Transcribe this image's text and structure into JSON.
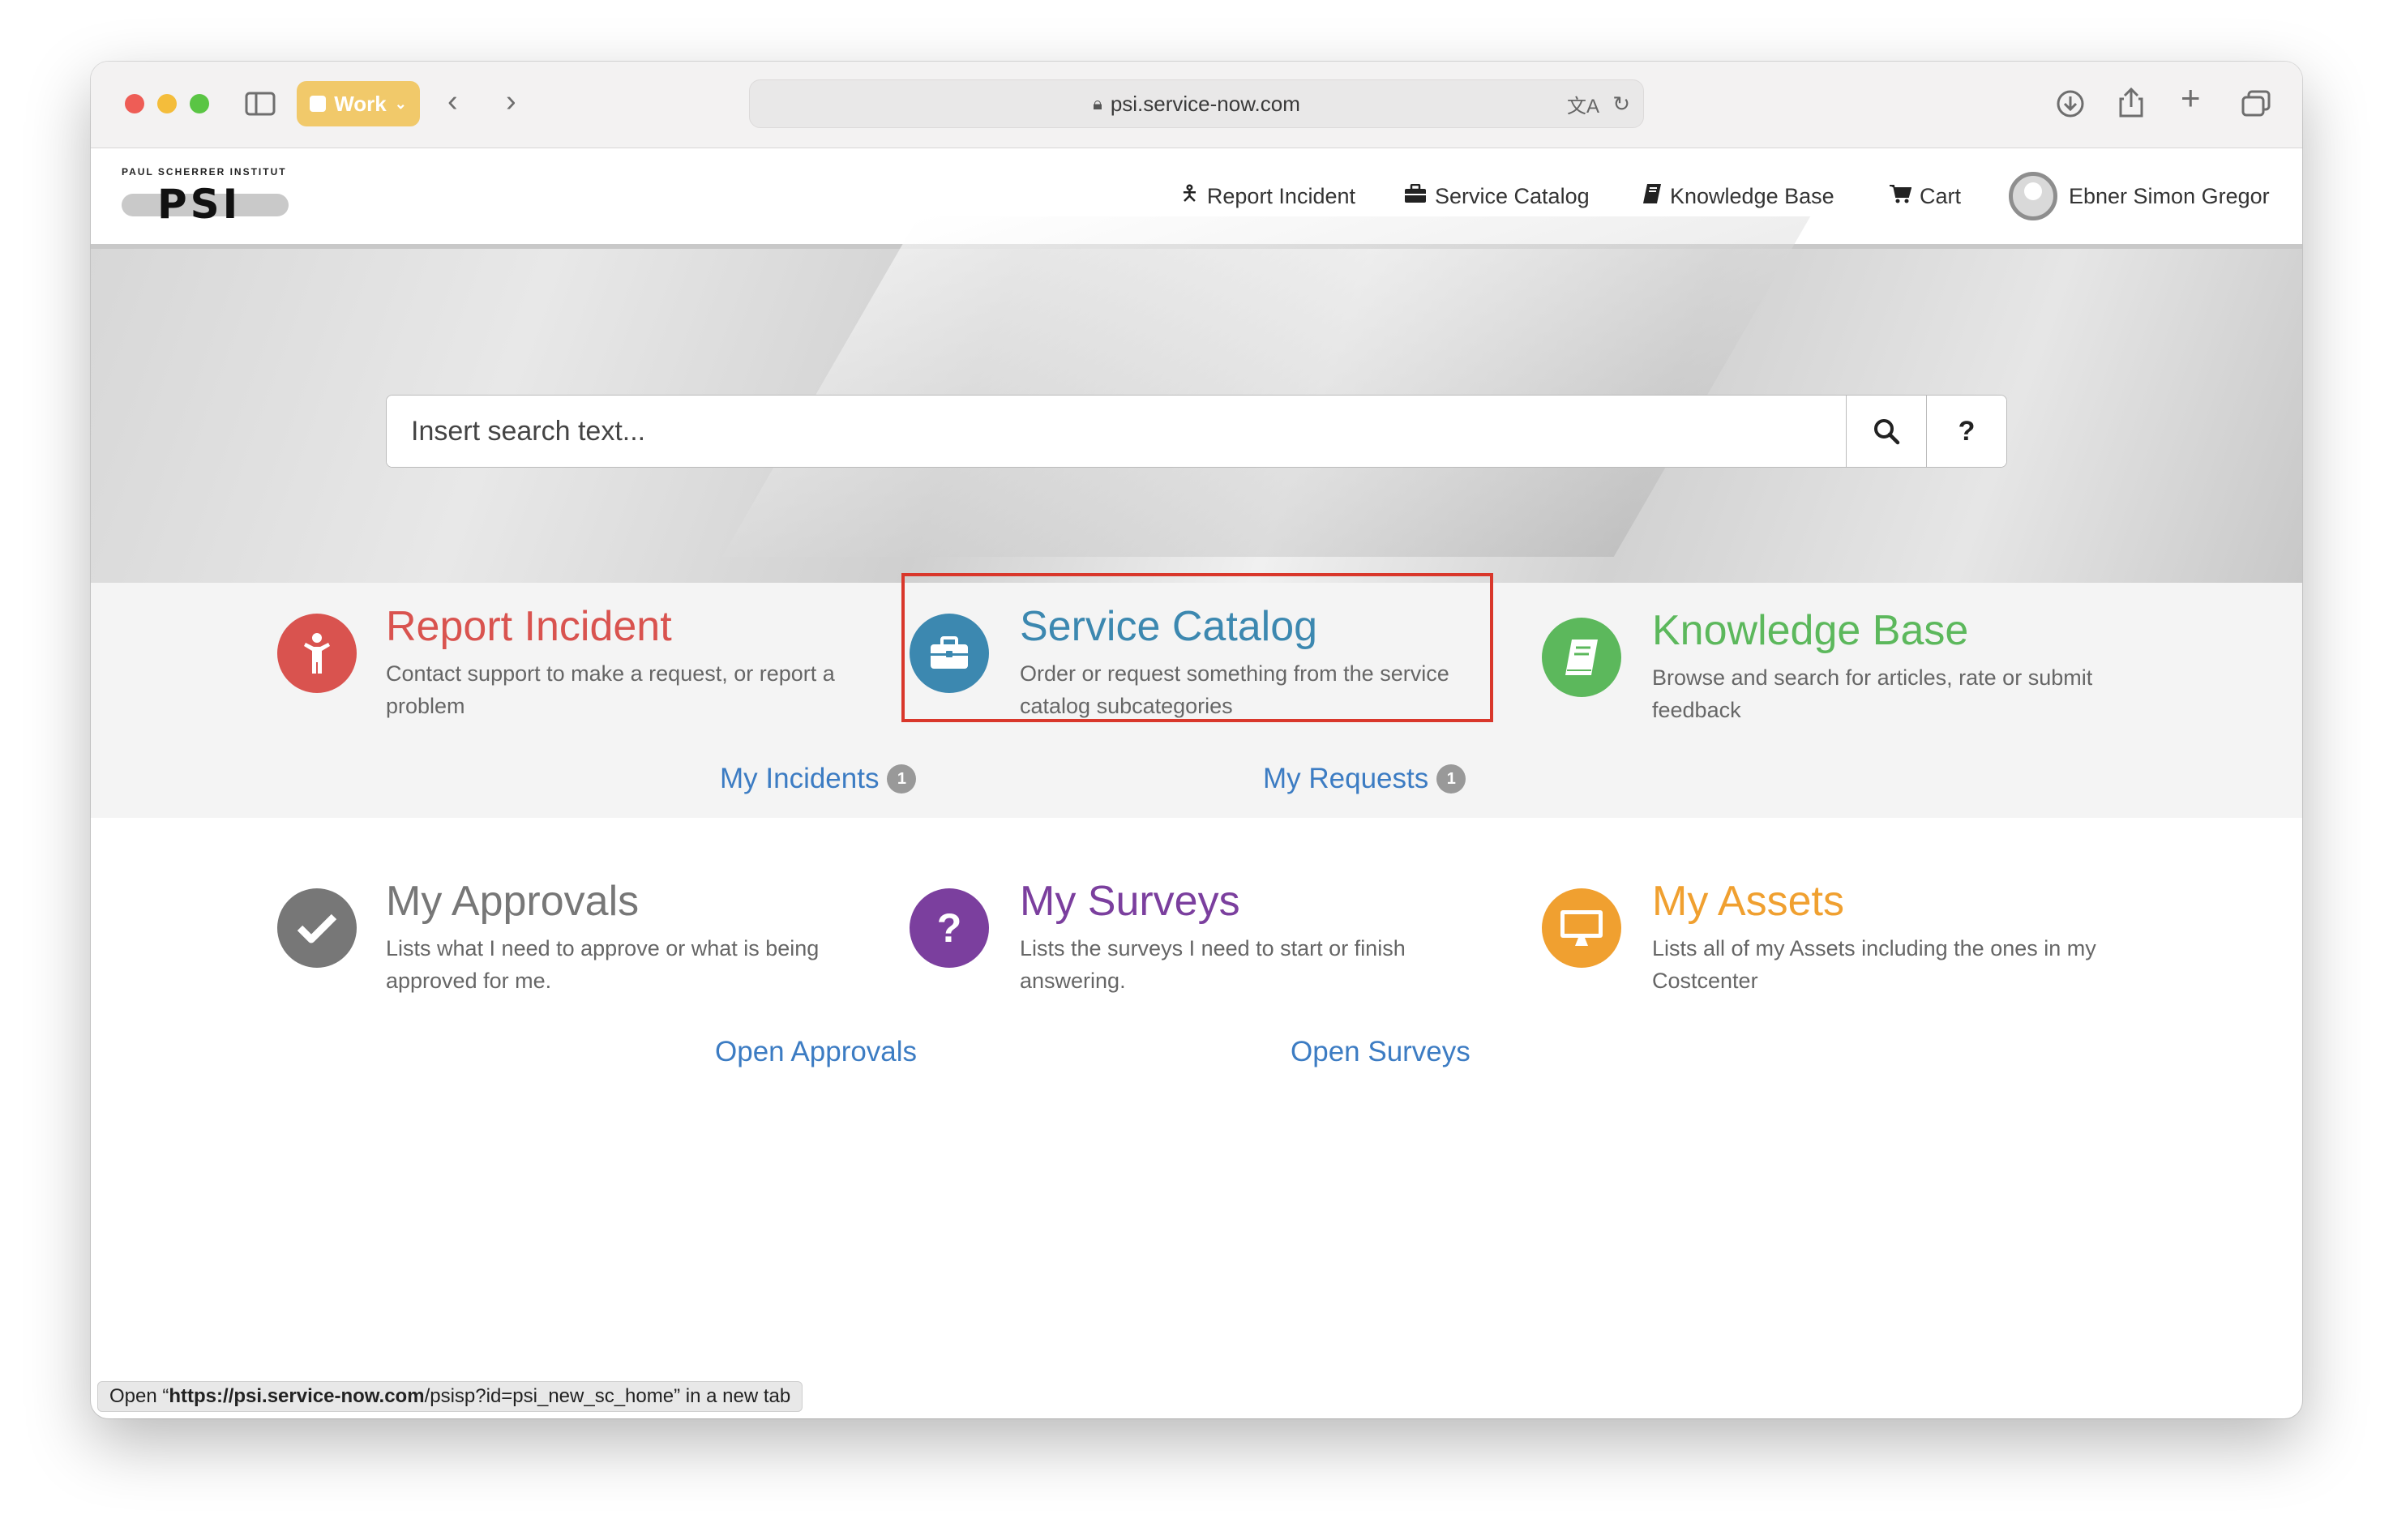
{
  "browser": {
    "tab_group": "Work",
    "url": "psi.service-now.com"
  },
  "header": {
    "logo_text": "PAUL SCHERRER INSTITUT",
    "logo_mark": "PSI",
    "nav": [
      {
        "label": "Report Incident",
        "icon": "person-icon"
      },
      {
        "label": "Service Catalog",
        "icon": "briefcase-icon"
      },
      {
        "label": "Knowledge Base",
        "icon": "book-icon"
      },
      {
        "label": "Cart",
        "icon": "cart-icon"
      }
    ],
    "user": "Ebner Simon Gregor"
  },
  "search": {
    "placeholder": "Insert search text...",
    "help_label": "?"
  },
  "tiles": [
    {
      "title": "Report Incident",
      "description": "Contact support to make a request, or report a problem",
      "link": "My Incidents",
      "badge": "1",
      "color": "#d9534f",
      "icon": "person-icon"
    },
    {
      "title": "Service Catalog",
      "description": "Order or request something from the service catalog subcategories",
      "link": "My Requests",
      "badge": "1",
      "color": "#3c88b0",
      "icon": "briefcase-icon"
    },
    {
      "title": "Knowledge Base",
      "description": "Browse and search for articles, rate or submit feedback",
      "color": "#5cb85c",
      "icon": "book-icon"
    },
    {
      "title": "My Approvals",
      "description": "Lists what I need to approve or what is being approved for me.",
      "link": "Open Approvals",
      "color": "#777777",
      "icon": "check-icon"
    },
    {
      "title": "My Surveys",
      "description": "Lists the surveys I need to start or finish answering.",
      "link": "Open Surveys",
      "color": "#7b3f9e",
      "icon": "question-icon"
    },
    {
      "title": "My Assets",
      "description": "Lists all of my Assets including the ones in my Costcenter",
      "color": "#f0a030",
      "icon": "monitor-icon"
    }
  ],
  "status_bar": {
    "prefix": "Open “",
    "url_bold": "https://psi.service-now.com",
    "url_rest": "/psisp?id=psi_new_sc_home",
    "suffix": "” in a new tab"
  }
}
